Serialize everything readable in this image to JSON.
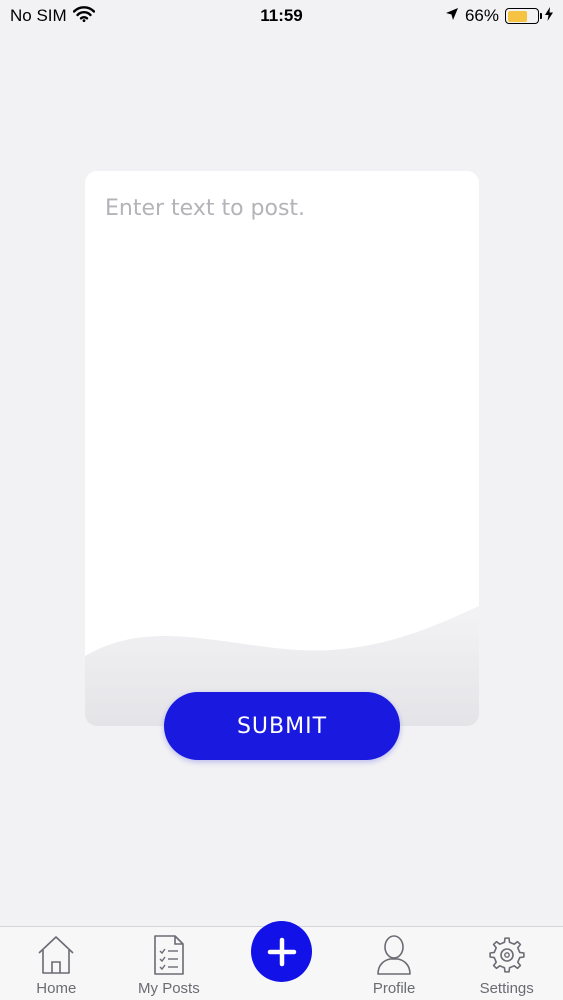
{
  "status_bar": {
    "carrier": "No SIM",
    "time": "11:59",
    "battery_percent_text": "66%",
    "battery_level": 0.66,
    "icons": [
      "wifi-icon",
      "location-arrow-icon",
      "battery-icon",
      "charging-bolt-icon"
    ]
  },
  "composer": {
    "placeholder": "Enter text to post.",
    "value": "",
    "submit_label": "SUBMIT"
  },
  "tab_bar": {
    "tabs": [
      {
        "label": "Home",
        "icon": "home-icon"
      },
      {
        "label": "My Posts",
        "icon": "document-list-icon"
      },
      {
        "label": "Profile",
        "icon": "profile-icon"
      },
      {
        "label": "Settings",
        "icon": "gear-icon"
      }
    ],
    "center_action_icon": "plus-icon"
  },
  "colors": {
    "accent": "#1919e0",
    "background": "#f2f2f4",
    "card": "#ffffff",
    "placeholder": "#b3b3b8",
    "tab_label": "#6b6b73",
    "battery": "#f5c242"
  }
}
